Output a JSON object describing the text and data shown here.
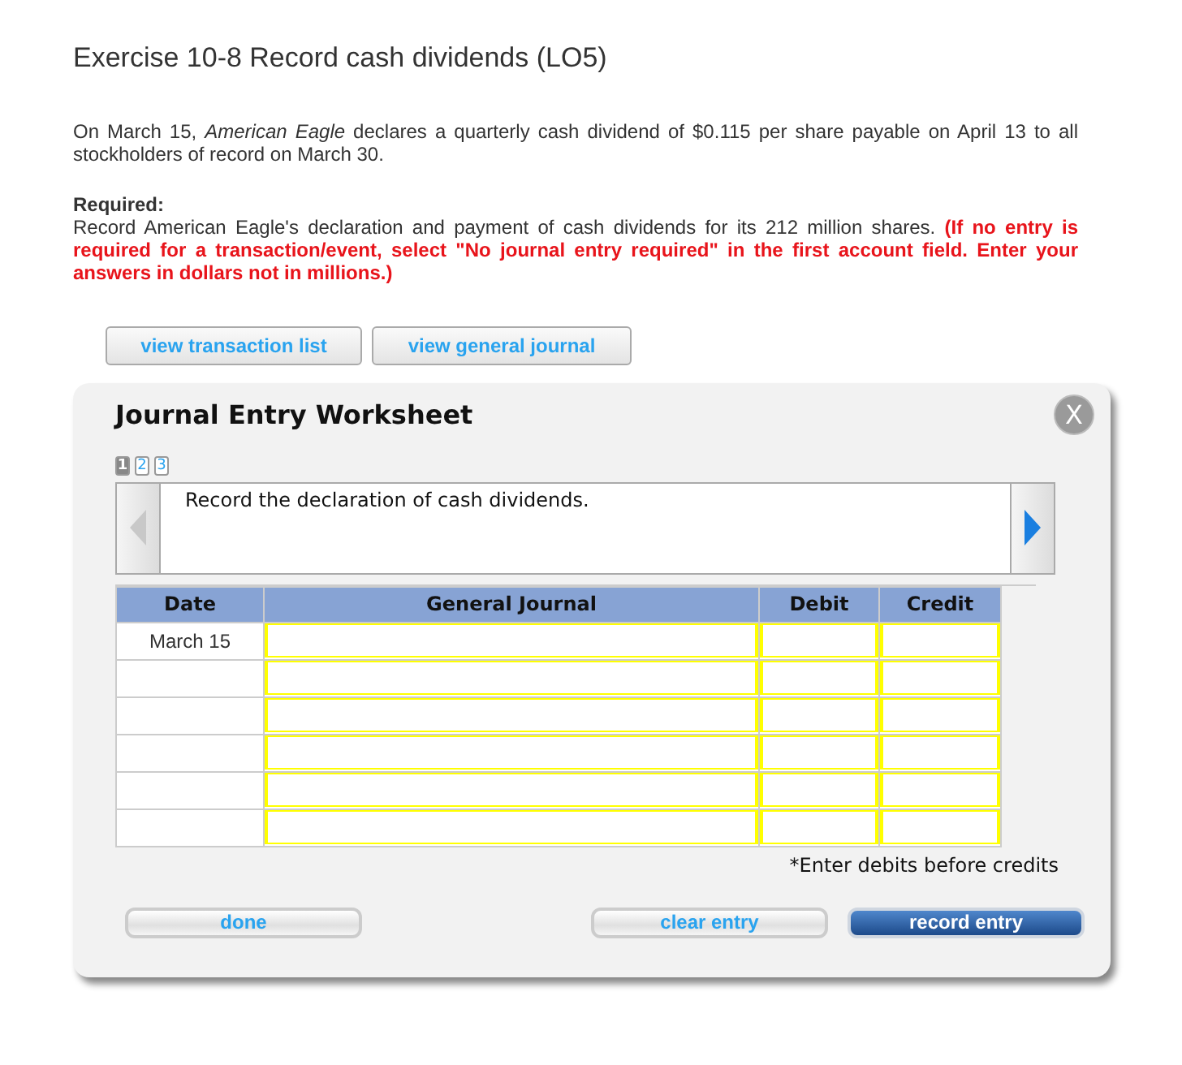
{
  "title": "Exercise 10-8 Record cash dividends (LO5)",
  "problem": "On March 15, *American Eagle* declares a quarterly cash dividend of $0.115 per share payable on April 13 to all stockholders of record on March 30.",
  "required": {
    "label": "Required:",
    "text": "Record American Eagle's declaration and payment of cash dividends for its 212 million shares. **(If no entry is required for a transaction/event, select \"No journal entry required\" in the first account field. Enter your answers in dollars not in millions.)**"
  },
  "view_buttons": [
    "view transaction list",
    "view general journal"
  ],
  "worksheet": {
    "title": "Journal Entry Worksheet",
    "close": "X",
    "steps": [
      {
        "label": "1",
        "selected": true
      },
      {
        "label": "2",
        "selected": false
      },
      {
        "label": "3",
        "selected": false
      }
    ],
    "prev": {
      "disabled": true
    },
    "next": {
      "disabled": false
    },
    "instruction": "Record the declaration of cash dividends.",
    "columns": [
      "Date",
      "General Journal",
      "Debit",
      "Credit"
    ],
    "rows": [
      {
        "date": "March 15"
      },
      {},
      {},
      {},
      {},
      {}
    ],
    "note": "*Enter debits before credits",
    "buttons": [
      {
        "label": "done",
        "kind": "plain"
      },
      {
        "label": "clear entry",
        "kind": "plain"
      },
      {
        "label": "record entry",
        "kind": "primary"
      }
    ]
  }
}
